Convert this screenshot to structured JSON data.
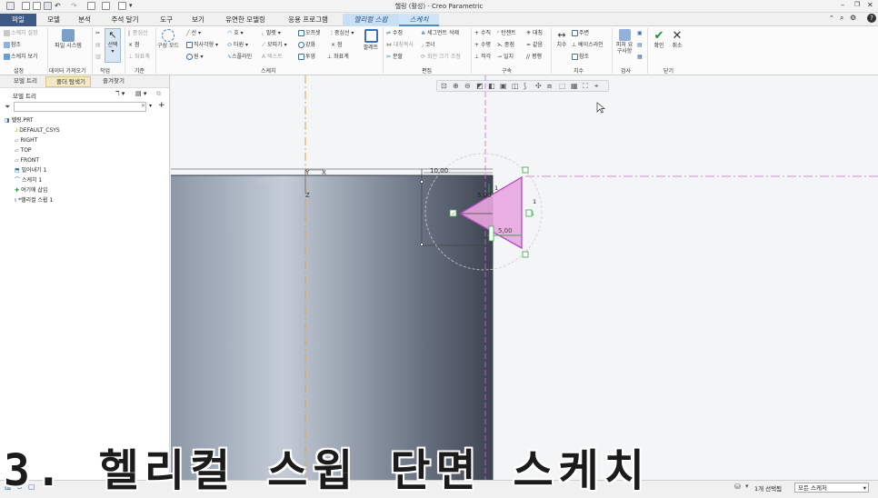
{
  "window": {
    "title": "헬링 (활성) - Creo Parametric"
  },
  "tabs": [
    {
      "label": "파일"
    },
    {
      "label": "모델"
    },
    {
      "label": "분석"
    },
    {
      "label": "주석 달기"
    },
    {
      "label": "도구"
    },
    {
      "label": "보기"
    },
    {
      "label": "유연한 모델링"
    },
    {
      "label": "응용 프로그램"
    },
    {
      "label": "헬리컬 스윕"
    },
    {
      "label": "스케치"
    }
  ],
  "ribbon": {
    "setup": {
      "sketch_setup": "스케치 설정",
      "reference": "참조",
      "sketch_view": "스케치 보기",
      "group": "설정"
    },
    "get_data": {
      "file_system": "파일 시스템",
      "group": "데이터 가져오기"
    },
    "operations": {
      "select": "선택",
      "group": "작업"
    },
    "datum": {
      "centerline": "중심선",
      "point": "점",
      "csys": "좌표계",
      "group": "기준"
    },
    "sketching": {
      "construction_mode": "구성 모드",
      "line": "선",
      "arc": "호",
      "fillet": "필렛",
      "offset": "오프셋",
      "centerline": "중심선",
      "rectangle": "직사각형",
      "ellipse": "타원",
      "chamfer": "모따기",
      "thicken": "강화",
      "point": "점",
      "circle": "원",
      "spline": "스플라인",
      "text": "텍스트",
      "project": "투영",
      "csys": "좌표계",
      "palette": "팔레트",
      "group": "스케치"
    },
    "editing": {
      "modify": "수정",
      "delete_segment": "세그먼트 삭제",
      "mirror": "대칭복사",
      "corner": "코너",
      "divide": "분할",
      "rotate_resize": "회전 크기 조정",
      "group": "편집"
    },
    "constrain": {
      "vertical": "수직",
      "tangent": "탄젠트",
      "symmetric": "대칭",
      "horizontal": "수평",
      "midpoint": "중점",
      "equal": "같음",
      "perpendicular": "직각",
      "coincident": "일치",
      "parallel": "평행",
      "group": "구속"
    },
    "dimension": {
      "dimension": "치수",
      "perimeter": "주변",
      "baseline": "베이스라인",
      "reference": "참조",
      "group": "치수"
    },
    "inspect": {
      "feature_requirements": "피처 요구사항",
      "group": "검사"
    },
    "close": {
      "ok": "확인",
      "cancel": "취소",
      "group": "닫기"
    }
  },
  "left_panel": {
    "tabs": [
      {
        "label": "모델 트리"
      },
      {
        "label": "폴더 탐색기"
      },
      {
        "label": "즐겨찾기"
      }
    ],
    "header": "모델 트리",
    "search_placeholder": "",
    "tree": [
      {
        "label": "헬링.PRT",
        "icon": "part-icon"
      },
      {
        "label": "DEFAULT_CSYS",
        "icon": "csys-icon"
      },
      {
        "label": "RIGHT",
        "icon": "datum-plane-icon"
      },
      {
        "label": "TOP",
        "icon": "datum-plane-icon"
      },
      {
        "label": "FRONT",
        "icon": "datum-plane-icon"
      },
      {
        "label": "밀어내기 1",
        "icon": "extrude-icon"
      },
      {
        "label": "스케치 1",
        "icon": "sketch-icon"
      },
      {
        "label": "여기에 삽입",
        "icon": "insert-here-icon"
      },
      {
        "label": "*헬리컬 스윕 1",
        "icon": "helical-sweep-icon"
      }
    ]
  },
  "viewport": {
    "csys_label": "DEFAULT_CSYS",
    "axis_x": "X",
    "axis_y": "Y",
    "axis_z": "Z",
    "dim_top": "10,00",
    "dim_mid": "5,00",
    "dim_lower": "5,00",
    "constraint_labels": [
      "1",
      "1",
      "1"
    ],
    "colors": {
      "section_fill": "#e9a7df",
      "section_edge": "#b44ac0",
      "accent_green": "#3aa34a",
      "dash_magenta": "#c66ad0",
      "dash_orange": "#d9a441"
    }
  },
  "status": {
    "selection": "1개 선택됨",
    "filter": "모든 스케처"
  },
  "caption": "3. 헬리컬 스윕 단면 스케치"
}
